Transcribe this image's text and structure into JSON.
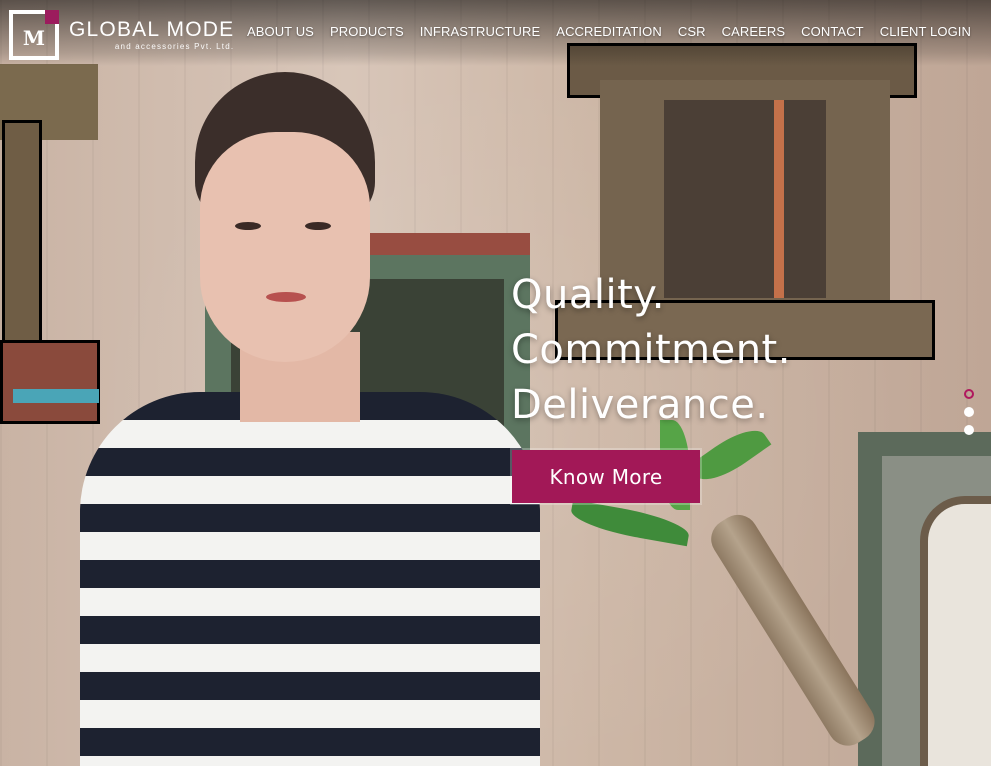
{
  "brand": {
    "name": "GLOBAL MODE",
    "tagline": "and accessories Pvt. Ltd.",
    "mark_letter": "M",
    "accent": "#a21857"
  },
  "nav": {
    "items": [
      {
        "label": "ABOUT US"
      },
      {
        "label": "PRODUCTS"
      },
      {
        "label": "INFRASTRUCTURE"
      },
      {
        "label": "ACCREDITATION"
      },
      {
        "label": "CSR"
      },
      {
        "label": "CAREERS"
      },
      {
        "label": "CONTACT"
      },
      {
        "label": "CLIENT LOGIN"
      }
    ]
  },
  "hero": {
    "headline": [
      "Quality.",
      "Commitment.",
      "Deliverance."
    ],
    "cta_label": "Know More",
    "slides": {
      "count": 3,
      "active_index": 0
    }
  }
}
